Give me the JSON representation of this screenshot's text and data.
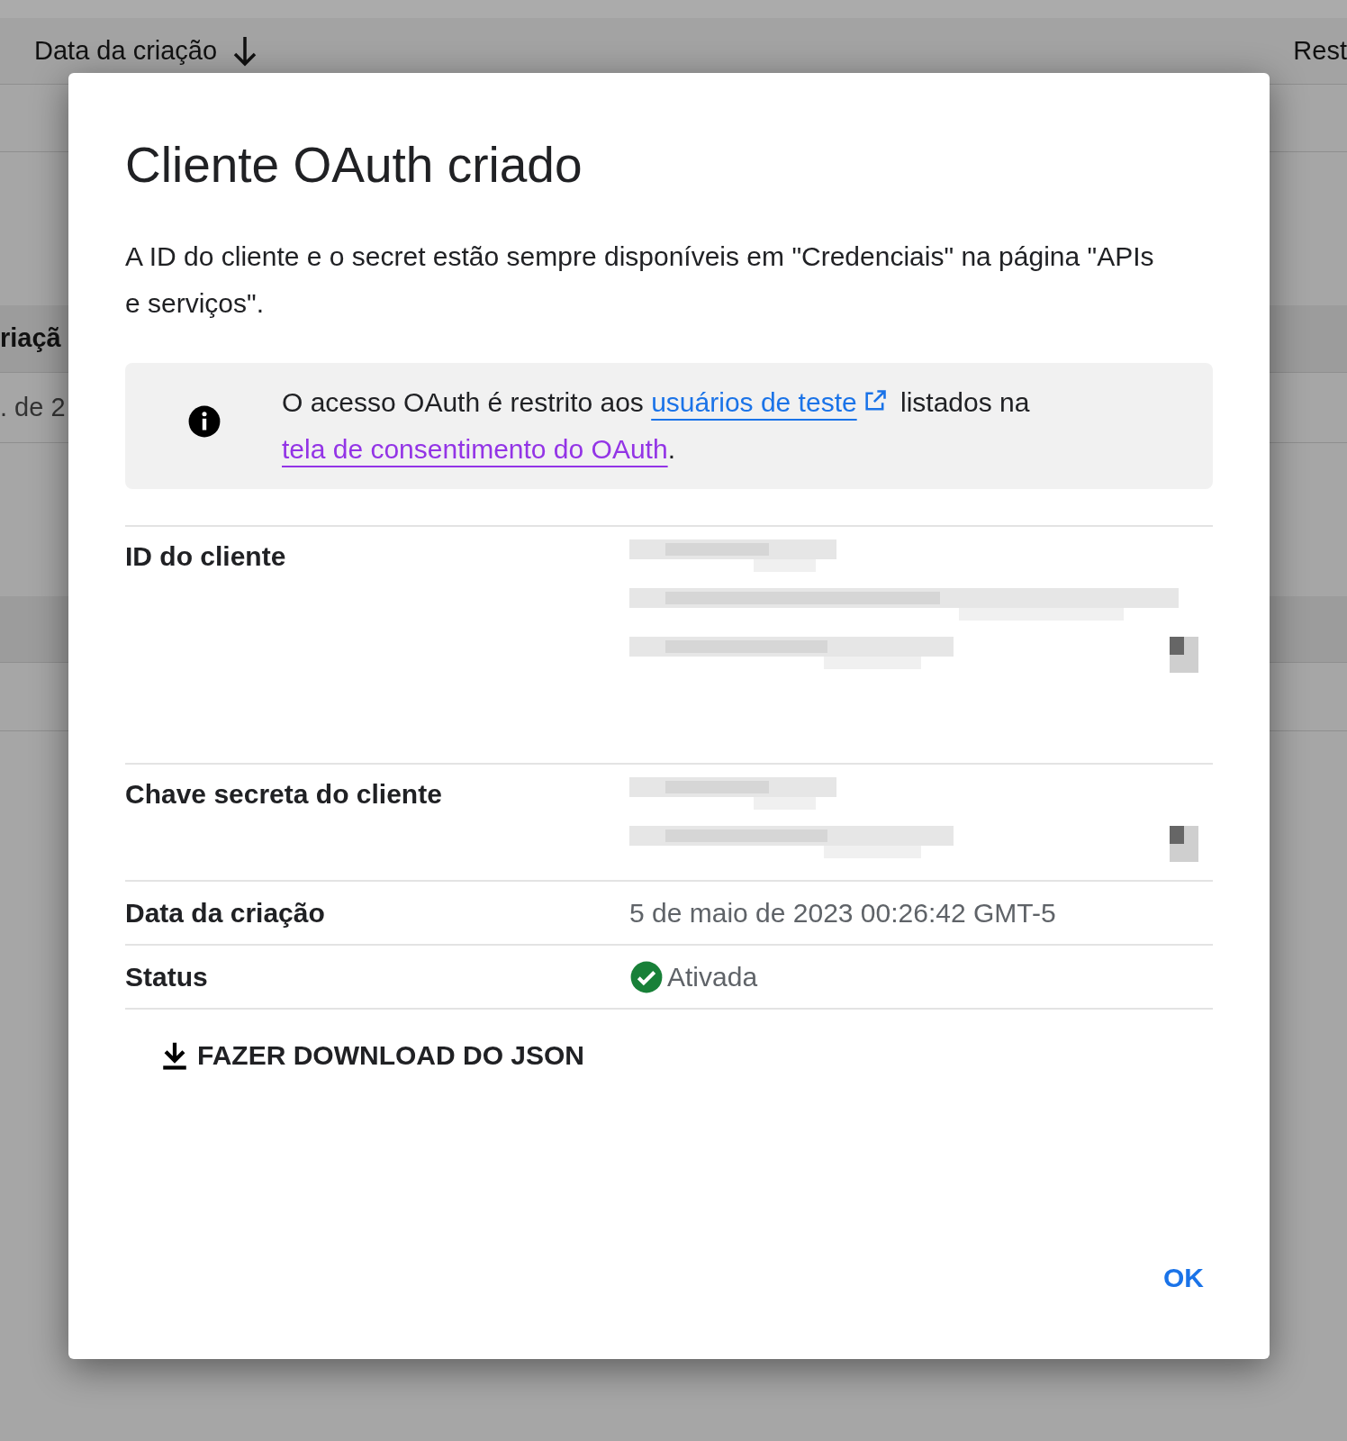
{
  "background": {
    "header": {
      "label": "Data da criação",
      "right_label": "Rest"
    },
    "column_header": "riaçã",
    "cell": ". de 2"
  },
  "dialog": {
    "title": "Cliente OAuth criado",
    "description": "A ID do cliente e o secret estão sempre disponíveis em \"Credenciais\" na página \"APIs e serviços\".",
    "notice": {
      "before": "O acesso OAuth é restrito aos ",
      "link": "usuários de teste",
      "middle": " listados na ",
      "link2": "tela de consentimento do OAuth",
      "after": "."
    },
    "fields": [
      {
        "label": "ID do cliente",
        "kind": "redacted"
      },
      {
        "label": "Chave secreta do cliente",
        "kind": "redacted"
      },
      {
        "label": "Data da criação",
        "kind": "text",
        "value": "5 de maio de 2023 00:26:42 GMT-5"
      },
      {
        "label": "Status",
        "kind": "status",
        "value": "Ativada"
      }
    ],
    "download_button": "FAZER DOWNLOAD DO JSON",
    "ok_button": "OK"
  }
}
